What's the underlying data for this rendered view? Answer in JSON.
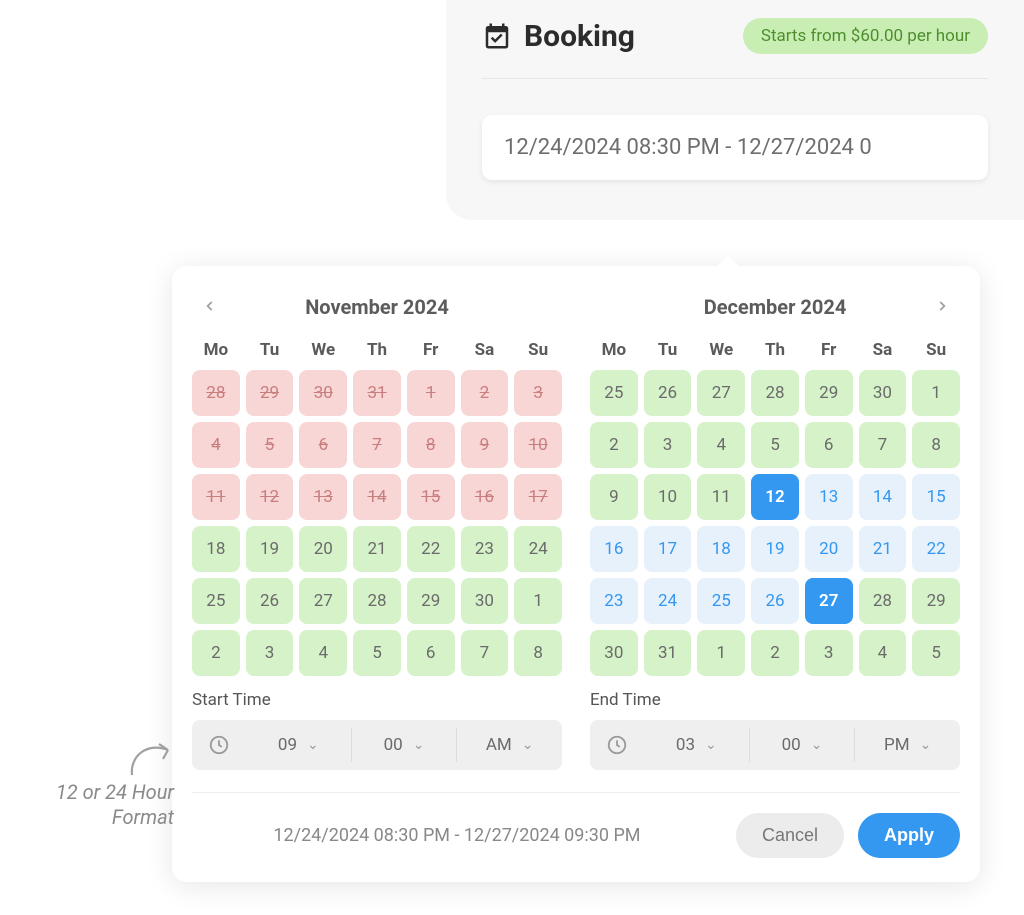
{
  "booking": {
    "title": "Booking",
    "pricePill": "Starts from $60.00 per hour",
    "inputValue": "12/24/2024 08:30 PM - 12/27/2024 0"
  },
  "annotation": {
    "text": "12 or 24 Hour Format"
  },
  "picker": {
    "weekdays": [
      "Mo",
      "Tu",
      "We",
      "Th",
      "Fr",
      "Sa",
      "Su"
    ],
    "months": [
      {
        "title": "November 2024",
        "nav": "prev",
        "weeks": [
          [
            {
              "d": "28",
              "s": "disabled"
            },
            {
              "d": "29",
              "s": "disabled"
            },
            {
              "d": "30",
              "s": "disabled"
            },
            {
              "d": "31",
              "s": "disabled"
            },
            {
              "d": "1",
              "s": "disabled"
            },
            {
              "d": "2",
              "s": "disabled"
            },
            {
              "d": "3",
              "s": "disabled"
            }
          ],
          [
            {
              "d": "4",
              "s": "disabled"
            },
            {
              "d": "5",
              "s": "disabled"
            },
            {
              "d": "6",
              "s": "disabled"
            },
            {
              "d": "7",
              "s": "disabled"
            },
            {
              "d": "8",
              "s": "disabled"
            },
            {
              "d": "9",
              "s": "disabled"
            },
            {
              "d": "10",
              "s": "disabled"
            }
          ],
          [
            {
              "d": "11",
              "s": "disabled"
            },
            {
              "d": "12",
              "s": "disabled"
            },
            {
              "d": "13",
              "s": "disabled"
            },
            {
              "d": "14",
              "s": "disabled"
            },
            {
              "d": "15",
              "s": "disabled"
            },
            {
              "d": "16",
              "s": "disabled"
            },
            {
              "d": "17",
              "s": "disabled"
            }
          ],
          [
            {
              "d": "18",
              "s": "avail"
            },
            {
              "d": "19",
              "s": "avail"
            },
            {
              "d": "20",
              "s": "avail"
            },
            {
              "d": "21",
              "s": "avail"
            },
            {
              "d": "22",
              "s": "avail"
            },
            {
              "d": "23",
              "s": "avail"
            },
            {
              "d": "24",
              "s": "avail"
            }
          ],
          [
            {
              "d": "25",
              "s": "avail"
            },
            {
              "d": "26",
              "s": "avail"
            },
            {
              "d": "27",
              "s": "avail"
            },
            {
              "d": "28",
              "s": "avail"
            },
            {
              "d": "29",
              "s": "avail"
            },
            {
              "d": "30",
              "s": "avail"
            },
            {
              "d": "1",
              "s": "avail"
            }
          ],
          [
            {
              "d": "2",
              "s": "avail"
            },
            {
              "d": "3",
              "s": "avail"
            },
            {
              "d": "4",
              "s": "avail"
            },
            {
              "d": "5",
              "s": "avail"
            },
            {
              "d": "6",
              "s": "avail"
            },
            {
              "d": "7",
              "s": "avail"
            },
            {
              "d": "8",
              "s": "avail"
            }
          ]
        ]
      },
      {
        "title": "December 2024",
        "nav": "next",
        "weeks": [
          [
            {
              "d": "25",
              "s": "avail"
            },
            {
              "d": "26",
              "s": "avail"
            },
            {
              "d": "27",
              "s": "avail"
            },
            {
              "d": "28",
              "s": "avail"
            },
            {
              "d": "29",
              "s": "avail"
            },
            {
              "d": "30",
              "s": "avail"
            },
            {
              "d": "1",
              "s": "avail"
            }
          ],
          [
            {
              "d": "2",
              "s": "avail"
            },
            {
              "d": "3",
              "s": "avail"
            },
            {
              "d": "4",
              "s": "avail"
            },
            {
              "d": "5",
              "s": "avail"
            },
            {
              "d": "6",
              "s": "avail"
            },
            {
              "d": "7",
              "s": "avail"
            },
            {
              "d": "8",
              "s": "avail"
            }
          ],
          [
            {
              "d": "9",
              "s": "avail"
            },
            {
              "d": "10",
              "s": "avail"
            },
            {
              "d": "11",
              "s": "avail"
            },
            {
              "d": "12",
              "s": "selected"
            },
            {
              "d": "13",
              "s": "range"
            },
            {
              "d": "14",
              "s": "range"
            },
            {
              "d": "15",
              "s": "range"
            }
          ],
          [
            {
              "d": "16",
              "s": "range"
            },
            {
              "d": "17",
              "s": "range"
            },
            {
              "d": "18",
              "s": "range"
            },
            {
              "d": "19",
              "s": "range"
            },
            {
              "d": "20",
              "s": "range"
            },
            {
              "d": "21",
              "s": "range"
            },
            {
              "d": "22",
              "s": "range"
            }
          ],
          [
            {
              "d": "23",
              "s": "range"
            },
            {
              "d": "24",
              "s": "range"
            },
            {
              "d": "25",
              "s": "range"
            },
            {
              "d": "26",
              "s": "range"
            },
            {
              "d": "27",
              "s": "selected"
            },
            {
              "d": "28",
              "s": "avail"
            },
            {
              "d": "29",
              "s": "avail"
            }
          ],
          [
            {
              "d": "30",
              "s": "avail"
            },
            {
              "d": "31",
              "s": "avail"
            },
            {
              "d": "1",
              "s": "avail"
            },
            {
              "d": "2",
              "s": "avail"
            },
            {
              "d": "3",
              "s": "avail"
            },
            {
              "d": "4",
              "s": "avail"
            },
            {
              "d": "5",
              "s": "avail"
            }
          ]
        ]
      }
    ],
    "startTime": {
      "label": "Start Time",
      "hour": "09",
      "minute": "00",
      "period": "AM"
    },
    "endTime": {
      "label": "End Time",
      "hour": "03",
      "minute": "00",
      "period": "PM"
    },
    "footerRange": "12/24/2024 08:30 PM - 12/27/2024 09:30 PM",
    "cancel": "Cancel",
    "apply": "Apply"
  }
}
